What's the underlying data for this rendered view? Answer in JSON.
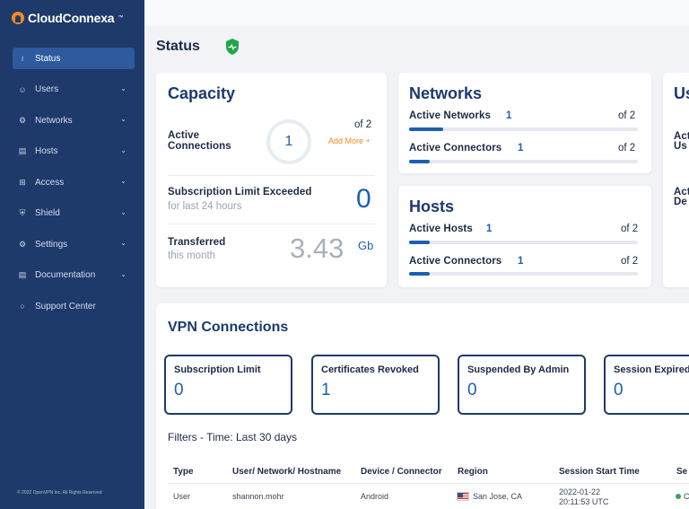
{
  "app": {
    "logo_text": "CloudConnexa",
    "logo_tm": "™"
  },
  "sidebar": {
    "items": [
      {
        "label": "Status",
        "icon": "chart-icon"
      },
      {
        "label": "Users",
        "icon": "users-icon"
      },
      {
        "label": "Networks",
        "icon": "network-icon"
      },
      {
        "label": "Hosts",
        "icon": "server-icon"
      },
      {
        "label": "Access",
        "icon": "access-icon"
      },
      {
        "label": "Shield",
        "icon": "shield-icon"
      },
      {
        "label": "Settings",
        "icon": "gear-icon"
      },
      {
        "label": "Documentation",
        "icon": "book-icon"
      },
      {
        "label": "Support Center",
        "icon": "chat-icon"
      }
    ],
    "copyright": "© 2022 OpenVPN Inc. All Rights Reserved"
  },
  "header": {
    "title": "Status"
  },
  "capacity": {
    "title": "Capacity",
    "active_connections_label_1": "Active",
    "active_connections_label_2": "Connections",
    "active_connections_value": "1",
    "active_connections_of": "of 2",
    "add_more": "Add More +",
    "limit_exceeded_label": "Subscription Limit Exceeded",
    "limit_exceeded_sub": "for last 24 hours",
    "limit_exceeded_value": "0",
    "transferred_label": "Transferred",
    "transferred_sub": "this month",
    "transferred_value": "3.43",
    "transferred_unit": "Gb"
  },
  "networks": {
    "title": "Networks",
    "rows": [
      {
        "label": "Active Networks",
        "value": "1",
        "of": "of 2",
        "fraction": 0.15
      },
      {
        "label": "Active Connectors",
        "value": "1",
        "of": "of 2",
        "fraction": 0.09
      }
    ]
  },
  "hosts": {
    "title": "Hosts",
    "rows": [
      {
        "label": "Active Hosts",
        "value": "1",
        "of": "of 2",
        "fraction": 0.09
      },
      {
        "label": "Active Connectors",
        "value": "1",
        "of": "of 2",
        "fraction": 0.09
      }
    ]
  },
  "users_card": {
    "title": "Us",
    "line1a": "Act",
    "line1b": "Us",
    "line2a": "Act",
    "line2b": "De"
  },
  "vpn": {
    "title": "VPN Connections",
    "boxes": [
      {
        "label": "Subscription Limit",
        "value": "0"
      },
      {
        "label": "Certificates Revoked",
        "value": "1"
      },
      {
        "label": "Suspended By Admin",
        "value": "0"
      },
      {
        "label": "Session Expired",
        "value": "0"
      }
    ],
    "filters": "Filters - Time: Last 30 days",
    "columns": [
      "Type",
      "User/ Network/ Hostname",
      "Device / Connector",
      "Region",
      "Session Start Time",
      "Se"
    ],
    "row": {
      "type": "User",
      "user": "shannon.mohr",
      "device": "Android",
      "region": "San Jose, CA",
      "start_date": "2022-01-22",
      "start_time": "20:11:53  UTC",
      "status": "C"
    }
  },
  "colors": {
    "sidebar": "#1e3a6a",
    "accent": "#1d5fb4",
    "add_more": "#f08a24",
    "shield": "#1fa64a"
  }
}
